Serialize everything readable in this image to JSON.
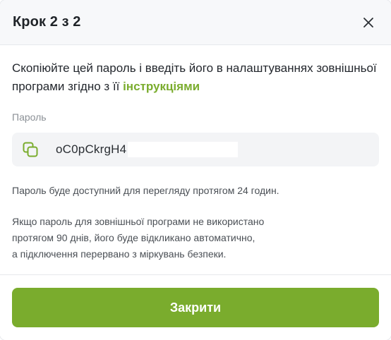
{
  "dialog": {
    "title": "Крок 2 з 2",
    "intro_text": "Скопіюйте цей пароль і введіть його в налаштуваннях зовнішньої програми згідно з її ",
    "intro_link": "інструкціями",
    "password_label": "Пароль",
    "password_value": "oC0pCkrgH4",
    "note_availability": "Пароль буде доступний для перегляду протягом 24 годин.",
    "note_expiry_line1": "Якщо пароль для зовнішньої програми не використано",
    "note_expiry_line2": "протягом 90 днів, його буде відкликано автоматично,",
    "note_expiry_line3": "а підключення перервано з міркувань безпеки.",
    "close_button_label": "Закрити"
  },
  "icons": {
    "close": "close-icon",
    "copy": "copy-icon"
  },
  "colors": {
    "accent": "#7aac2d",
    "header_bg": "#f7f8fa",
    "field_bg": "#f3f4f6"
  }
}
